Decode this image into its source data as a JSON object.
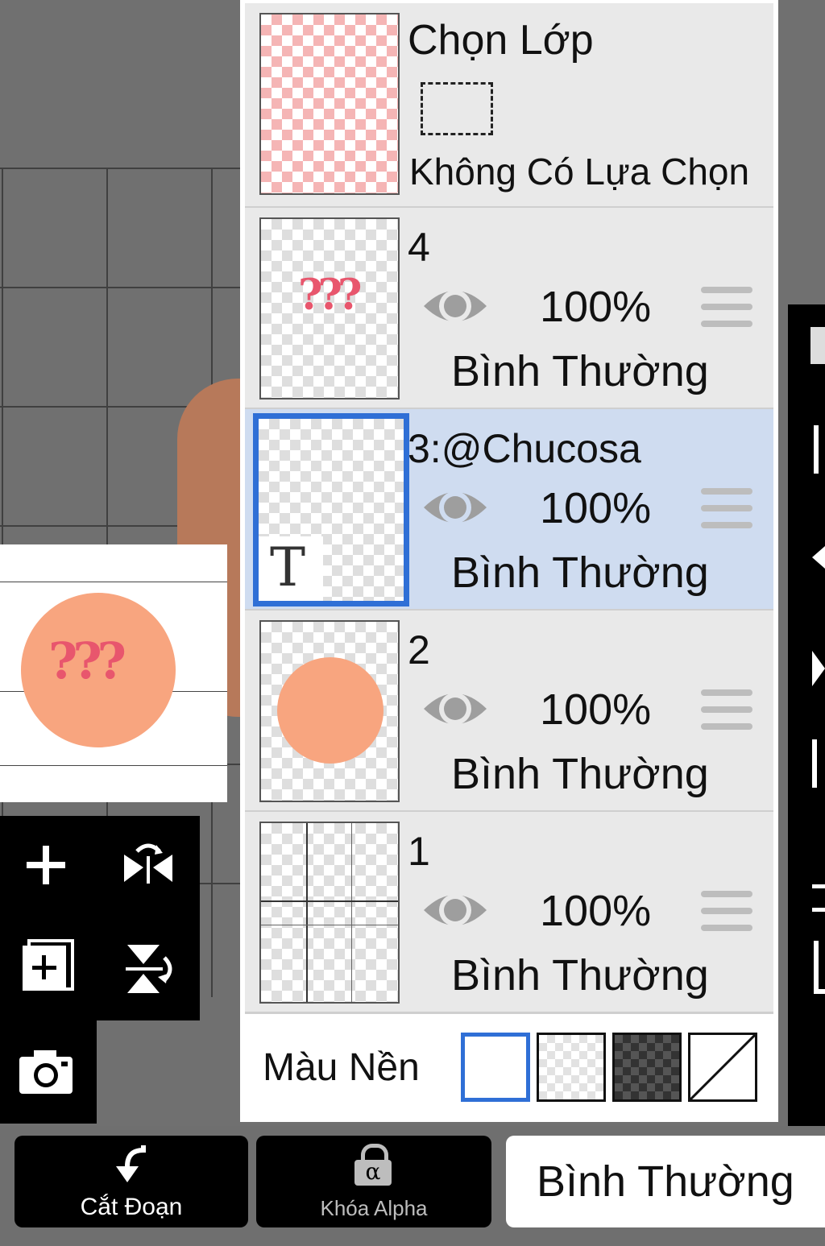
{
  "selection": {
    "title": "Chọn Lớp",
    "status": "Không Có Lựa Chọn"
  },
  "layers": [
    {
      "name": "4",
      "opacity": "100%",
      "blend": "Bình Thường",
      "selected": false
    },
    {
      "name": "3:@Chucosa",
      "opacity": "100%",
      "blend": "Bình Thường",
      "selected": true,
      "thumb_glyph": "T"
    },
    {
      "name": "2",
      "opacity": "100%",
      "blend": "Bình Thường",
      "selected": false
    },
    {
      "name": "1",
      "opacity": "100%",
      "blend": "Bình Thường",
      "selected": false
    }
  ],
  "background": {
    "label": "Màu Nền",
    "options": [
      "white",
      "transparent-light",
      "transparent-dark",
      "none"
    ],
    "selected": "white"
  },
  "preview": {
    "text": "???"
  },
  "bottom_bar": {
    "clip_label": "Cắt Đoạn",
    "alpha_lock_label": "Khóa Alpha",
    "alpha_glyph": "α",
    "blend_mode": "Bình Thường"
  },
  "tools": {
    "add_layer": "add-layer",
    "flip_horizontal": "flip-horizontal",
    "add_layer_copy": "add-layer-copy",
    "flip_vertical": "flip-vertical",
    "camera": "camera"
  },
  "colors": {
    "accent": "#2f6fd6",
    "selected_row": "#cfdcf0",
    "panel_bg": "#e9e9e9",
    "circle": "#f8a57f",
    "question_marks": "#e8566d"
  }
}
